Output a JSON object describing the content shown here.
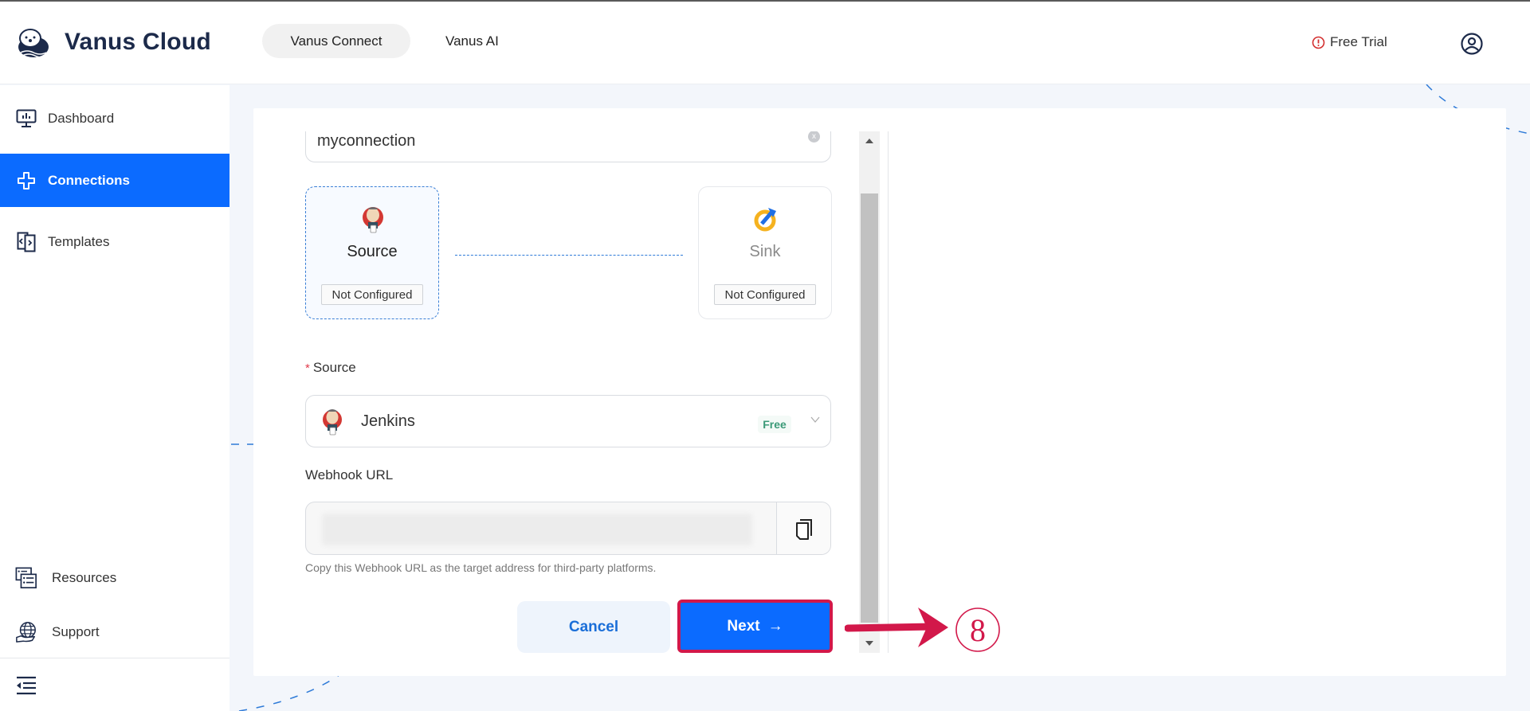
{
  "header": {
    "brand": "Vanus Cloud",
    "nav": [
      {
        "label": "Vanus Connect",
        "active": true
      },
      {
        "label": "Vanus AI",
        "active": false
      }
    ],
    "free_trial": "Free Trial",
    "icons": {
      "logo": "otter-logo-icon",
      "alert": "alert-circle-icon",
      "user": "user-circle-icon"
    }
  },
  "sidebar": {
    "items": [
      {
        "label": "Dashboard",
        "icon": "monitor-chart-icon",
        "active": false
      },
      {
        "label": "Connections",
        "icon": "connections-icon",
        "active": true
      },
      {
        "label": "Templates",
        "icon": "templates-icon",
        "active": false
      }
    ],
    "bottom_items": [
      {
        "label": "Resources",
        "icon": "resources-list-icon"
      },
      {
        "label": "Support",
        "icon": "globe-hand-icon"
      }
    ],
    "collapse_icon": "collapse-menu-icon"
  },
  "form": {
    "connection_name": "myconnection",
    "clear_icon": "x",
    "source_node": {
      "title": "Source",
      "status": "Not Configured",
      "icon": "jenkins-icon"
    },
    "sink_node": {
      "title": "Sink",
      "status": "Not Configured",
      "icon": "sink-icon"
    },
    "source_field": {
      "required_mark": "*",
      "label": "Source",
      "value": "Jenkins",
      "badge": "Free"
    },
    "webhook": {
      "label": "Webhook URL",
      "value": "",
      "helper": "Copy this Webhook URL as the target address for third-party platforms."
    },
    "buttons": {
      "cancel": "Cancel",
      "next": "Next",
      "next_arrow": "→"
    }
  },
  "annotation": {
    "step_number": "8",
    "color": "#d2184a"
  },
  "colors": {
    "primary": "#0b6bff",
    "brand_text": "#1c2a4a",
    "free_green": "#3b9a78",
    "alert_red": "#d32f2f"
  }
}
